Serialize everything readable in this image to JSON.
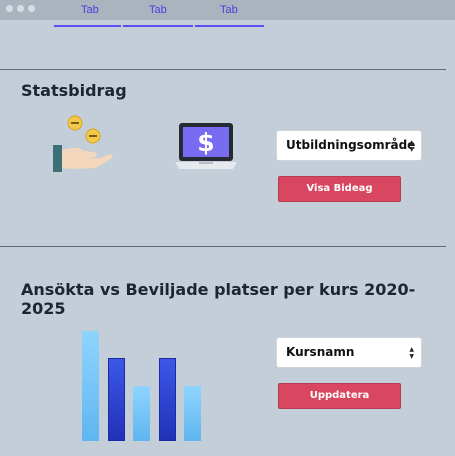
{
  "tabs": [
    "Tab",
    "Tab",
    "Tab"
  ],
  "sections": {
    "statsbidrag": {
      "title": "Statsbidrag",
      "select_value": "Utbildningsområde",
      "button_label": "Visa Bideag"
    },
    "ansokta": {
      "title": "Ansökta vs Beviljade platser per kurs 2020-2025",
      "select_value": "Kursnamn",
      "button_label": "Uppdatera"
    }
  },
  "icons": {
    "section1_left": "hand-coins-icon",
    "section1_right": "laptop-dollar-icon",
    "select_arrow": "chevron-updown-icon"
  },
  "chart_data": {
    "type": "bar",
    "values": [
      1.0,
      0.75,
      0.5,
      0.75,
      0.5
    ],
    "note_colors": [
      "light",
      "dark",
      "light",
      "dark",
      "light"
    ]
  },
  "colors": {
    "accent_tab": "#4a3ee0",
    "button": "#d9465f",
    "background": "#c3ced8"
  }
}
